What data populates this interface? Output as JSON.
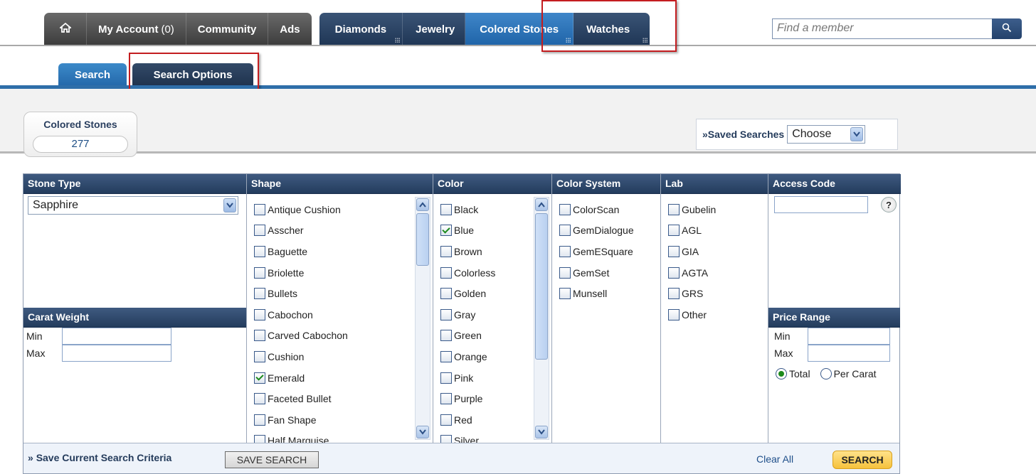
{
  "topnav": {
    "home_icon": "home-icon",
    "my_account": "My Account",
    "my_account_count": "(0)",
    "community": "Community",
    "ads": "Ads",
    "diamonds": "Diamonds",
    "jewelry": "Jewelry",
    "colored_stones": "Colored Stones",
    "watches": "Watches",
    "active_tab": "Colored Stones",
    "search_placeholder": "Find a member",
    "search_icon": "magnifier-icon"
  },
  "subtabs": {
    "search": "Search",
    "options": "Search Options",
    "active": "Search Options"
  },
  "summary": {
    "title": "Colored Stones",
    "count": "277"
  },
  "saved_searches": {
    "label": "Saved Searches",
    "prefix": "»",
    "value": "Choose"
  },
  "stone_type": {
    "header": "Stone Type",
    "value": "Sapphire"
  },
  "carat": {
    "header": "Carat Weight",
    "min_label": "Min",
    "max_label": "Max"
  },
  "shape": {
    "header": "Shape",
    "items": [
      {
        "label": "Antique Cushion",
        "checked": false
      },
      {
        "label": "Asscher",
        "checked": false
      },
      {
        "label": "Baguette",
        "checked": false
      },
      {
        "label": "Briolette",
        "checked": false
      },
      {
        "label": "Bullets",
        "checked": false
      },
      {
        "label": "Cabochon",
        "checked": false
      },
      {
        "label": "Carved Cabochon",
        "checked": false
      },
      {
        "label": "Cushion",
        "checked": false
      },
      {
        "label": "Emerald",
        "checked": true
      },
      {
        "label": "Faceted Bullet",
        "checked": false
      },
      {
        "label": "Fan Shape",
        "checked": false
      },
      {
        "label": "Half Marquise",
        "checked": false
      }
    ]
  },
  "color": {
    "header": "Color",
    "items": [
      {
        "label": "Black",
        "checked": false
      },
      {
        "label": "Blue",
        "checked": true
      },
      {
        "label": "Brown",
        "checked": false
      },
      {
        "label": "Colorless",
        "checked": false
      },
      {
        "label": "Golden",
        "checked": false
      },
      {
        "label": "Gray",
        "checked": false
      },
      {
        "label": "Green",
        "checked": false
      },
      {
        "label": "Orange",
        "checked": false
      },
      {
        "label": "Pink",
        "checked": false
      },
      {
        "label": "Purple",
        "checked": false
      },
      {
        "label": "Red",
        "checked": false
      },
      {
        "label": "Silver",
        "checked": false
      }
    ]
  },
  "color_system": {
    "header": "Color System",
    "items": [
      {
        "label": "ColorScan",
        "checked": false
      },
      {
        "label": "GemDialogue",
        "checked": false
      },
      {
        "label": "GemESquare",
        "checked": false
      },
      {
        "label": "GemSet",
        "checked": false
      },
      {
        "label": "Munsell",
        "checked": false
      }
    ]
  },
  "lab": {
    "header": "Lab",
    "items": [
      {
        "label": "Gubelin",
        "checked": false
      },
      {
        "label": "AGL",
        "checked": false
      },
      {
        "label": "GIA",
        "checked": false
      },
      {
        "label": "AGTA",
        "checked": false
      },
      {
        "label": "GRS",
        "checked": false
      },
      {
        "label": "Other",
        "checked": false
      }
    ]
  },
  "access_code": {
    "header": "Access Code",
    "help": "?"
  },
  "price": {
    "header": "Price Range",
    "min_label": "Min",
    "max_label": "Max",
    "total": "Total",
    "per_carat": "Per Carat",
    "selected": "Total"
  },
  "bottom": {
    "save_prefix": "»",
    "save_label": "Save Current Search Criteria",
    "save_button": "SAVE SEARCH",
    "clear_all": "Clear All",
    "search_button": "SEARCH"
  },
  "colors": {
    "nav_dark": "#4a4a4a",
    "nav_blue": "#24405f",
    "active_blue": "#2f78bd",
    "highlight_red": "#c41d20",
    "check_green": "#1c8a1c",
    "search_yellow": "#f6c23c"
  }
}
